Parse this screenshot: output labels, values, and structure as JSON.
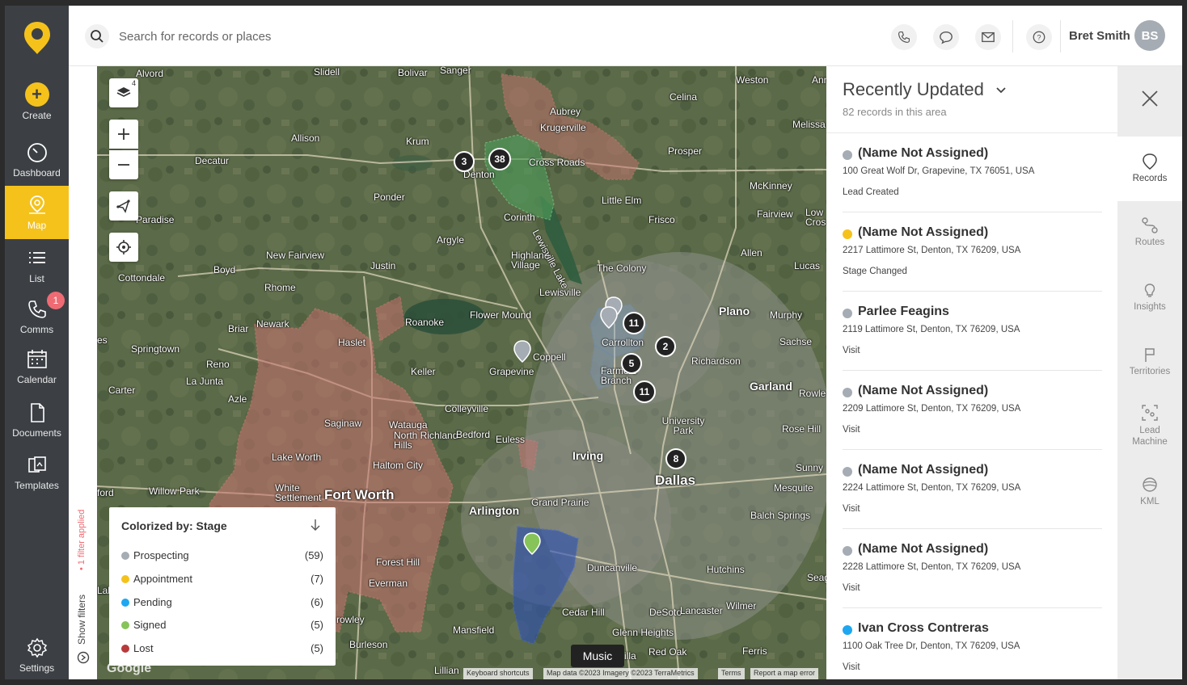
{
  "nav": {
    "create": "Create",
    "dashboard": "Dashboard",
    "map": "Map",
    "list": "List",
    "comms": "Comms",
    "comms_badge": "1",
    "calendar": "Calendar",
    "documents": "Documents",
    "templates": "Templates",
    "settings": "Settings"
  },
  "topbar": {
    "search_placeholder": "Search for records or places",
    "user_name": "Bret Smith",
    "user_initials": "BS"
  },
  "filters": {
    "show_filters": "Show filters",
    "applied": "1 filter applied"
  },
  "map": {
    "layers_count": "4",
    "labels": {
      "alvord": "Alvord",
      "slidell": "Slidell",
      "bolivar": "Bolivar",
      "sanger": "Sanger",
      "weston": "Weston",
      "anna": "Ann",
      "aubrey": "Aubrey",
      "krugerville": "Krugerville",
      "celina": "Celina",
      "melissa": "Melissa",
      "allison": "Allison",
      "krum": "Krum",
      "decatur": "Decatur",
      "denton": "Denton",
      "cross_roads": "Cross Roads",
      "prosper": "Prosper",
      "mckinney": "McKinney",
      "ponder": "Ponder",
      "little_elm": "Little Elm",
      "paradise": "Paradise",
      "corinth": "Corinth",
      "frisco": "Frisco",
      "fairview": "Fairview",
      "lowry": "Low Cros",
      "argyle": "Argyle",
      "new_fairview": "New Fairview",
      "boyd": "Boyd",
      "justin": "Justin",
      "highland_village": "Highland Village",
      "lewisville_lake": "Lewisville Lake",
      "the_colony": "The Colony",
      "allen": "Allen",
      "lucas": "Lucas",
      "cottondale": "Cottondale",
      "rhome": "Rhome",
      "lewisville": "Lewisville",
      "plano": "Plano",
      "murphy": "Murphy",
      "newark": "Newark",
      "briar": "Briar",
      "flower_mound": "Flower Mound",
      "roanoke": "Roanoke",
      "carrollton": "Carrollton",
      "sachse": "Sachse",
      "springtown": "Springtown",
      "haslet": "Haslet",
      "coppell": "Coppell",
      "richardson": "Richardson",
      "reno": "Reno",
      "la_junta": "La Junta",
      "keller": "Keller",
      "grapevine": "Grapevine",
      "farmers_branch": "Farmers Branch",
      "garland": "Garland",
      "rowlett": "Rowle",
      "carter": "Carter",
      "azle": "Azle",
      "colleyville": "Colleyville",
      "saginaw": "Saginaw",
      "watauga": "Watauga",
      "north_richland_hills": "North Richland Hills",
      "bedford": "Bedford",
      "euless": "Euless",
      "university_park": "University Park",
      "rose_hill": "Rose Hill",
      "lake_worth": "Lake Worth",
      "haltom_city": "Haltom City",
      "irving": "Irving",
      "sunnyvale": "Sunny",
      "willow_park": "Willow Park",
      "white_settlement": "White Settlement",
      "fort_worth": "Fort Worth",
      "dallas": "Dallas",
      "mesquite": "Mesquite",
      "grand_prairie": "Grand Prairie",
      "arlington": "Arlington",
      "balch_springs": "Balch Springs",
      "forest_hill": "Forest Hill",
      "everman": "Everman",
      "duncanville": "Duncanville",
      "hutchins": "Hutchins",
      "seagoville": "Seag",
      "cedar_hill": "Cedar Hill",
      "desoto": "DeSoto",
      "lancaster": "Lancaster",
      "wilmer": "Wilmer",
      "crowley": "rowley",
      "burleson": "Burleson",
      "mansfield": "Mansfield",
      "glenn_heights": "Glenn Heights",
      "red_oak": "Red Oak",
      "ferris": "Ferris",
      "lillian": "Lillian",
      "villa": "illa",
      "ford": "ford",
      "es": "es",
      "lak": "Lak"
    },
    "clusters": [
      "3",
      "38",
      "11",
      "2",
      "5",
      "11",
      "8"
    ],
    "music_tooltip": "Music",
    "google": "Google",
    "attribution": {
      "shortcuts": "Keyboard shortcuts",
      "map_data": "Map data ©2023 Imagery ©2023 TerraMetrics",
      "terms": "Terms",
      "report": "Report a map error"
    }
  },
  "legend": {
    "title": "Colorized by: Stage",
    "items": [
      {
        "label": "Prospecting",
        "count": "(59)",
        "color": "#a6acb3"
      },
      {
        "label": "Appointment",
        "count": "(7)",
        "color": "#f5c21b"
      },
      {
        "label": "Pending",
        "count": "(6)",
        "color": "#1ea7f0"
      },
      {
        "label": "Signed",
        "count": "(5)",
        "color": "#86c45a"
      },
      {
        "label": "Lost",
        "count": "(5)",
        "color": "#b83a3a"
      }
    ]
  },
  "panel": {
    "title": "Recently Updated",
    "subtitle": "82 records in this area",
    "records": [
      {
        "name": "(Name Not Assigned)",
        "address": "100 Great Wolf Dr, Grapevine, TX 76051, USA",
        "event": "Lead Created",
        "color": "#a6acb3"
      },
      {
        "name": "(Name Not Assigned)",
        "address": "2217 Lattimore St, Denton, TX 76209, USA",
        "event": "Stage Changed",
        "color": "#f5c21b"
      },
      {
        "name": "Parlee Feagins",
        "address": "2119 Lattimore St, Denton, TX 76209, USA",
        "event": "Visit",
        "color": "#a6acb3"
      },
      {
        "name": "(Name Not Assigned)",
        "address": "2209 Lattimore St, Denton, TX 76209, USA",
        "event": "Visit",
        "color": "#a6acb3"
      },
      {
        "name": "(Name Not Assigned)",
        "address": "2224 Lattimore St, Denton, TX 76209, USA",
        "event": "Visit",
        "color": "#a6acb3"
      },
      {
        "name": "(Name Not Assigned)",
        "address": "2228 Lattimore St, Denton, TX 76209, USA",
        "event": "Visit",
        "color": "#a6acb3"
      },
      {
        "name": "Ivan Cross Contreras",
        "address": "1100 Oak Tree Dr, Denton, TX 76209, USA",
        "event": "Visit",
        "color": "#1ea7f0"
      }
    ]
  },
  "righttabs": {
    "records": "Records",
    "routes": "Routes",
    "insights": "Insights",
    "territories": "Territories",
    "lead_machine": "Lead Machine",
    "kml": "KML"
  }
}
